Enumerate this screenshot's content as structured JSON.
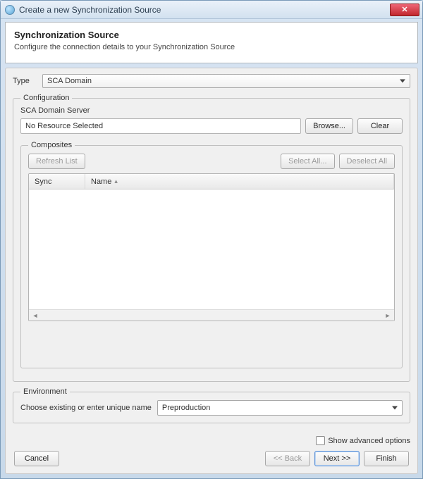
{
  "window": {
    "title": "Create a new Synchronization Source"
  },
  "header": {
    "heading": "Synchronization Source",
    "description": "Configure the connection details to your Synchronization Source"
  },
  "type": {
    "label": "Type",
    "value": "SCA Domain"
  },
  "configuration": {
    "legend": "Configuration",
    "server_label": "SCA Domain Server",
    "server_value": "No Resource Selected",
    "browse": "Browse...",
    "clear": "Clear"
  },
  "composites": {
    "legend": "Composites",
    "refresh": "Refresh List",
    "select_all": "Select All...",
    "deselect_all": "Deselect All",
    "columns": {
      "sync": "Sync",
      "name": "Name"
    }
  },
  "environment": {
    "legend": "Environment",
    "prompt": "Choose existing or enter unique name",
    "value": "Preproduction"
  },
  "advanced": {
    "label": "Show advanced options",
    "checked": false
  },
  "footer": {
    "cancel": "Cancel",
    "back": "<< Back",
    "next": "Next >>",
    "finish": "Finish"
  }
}
